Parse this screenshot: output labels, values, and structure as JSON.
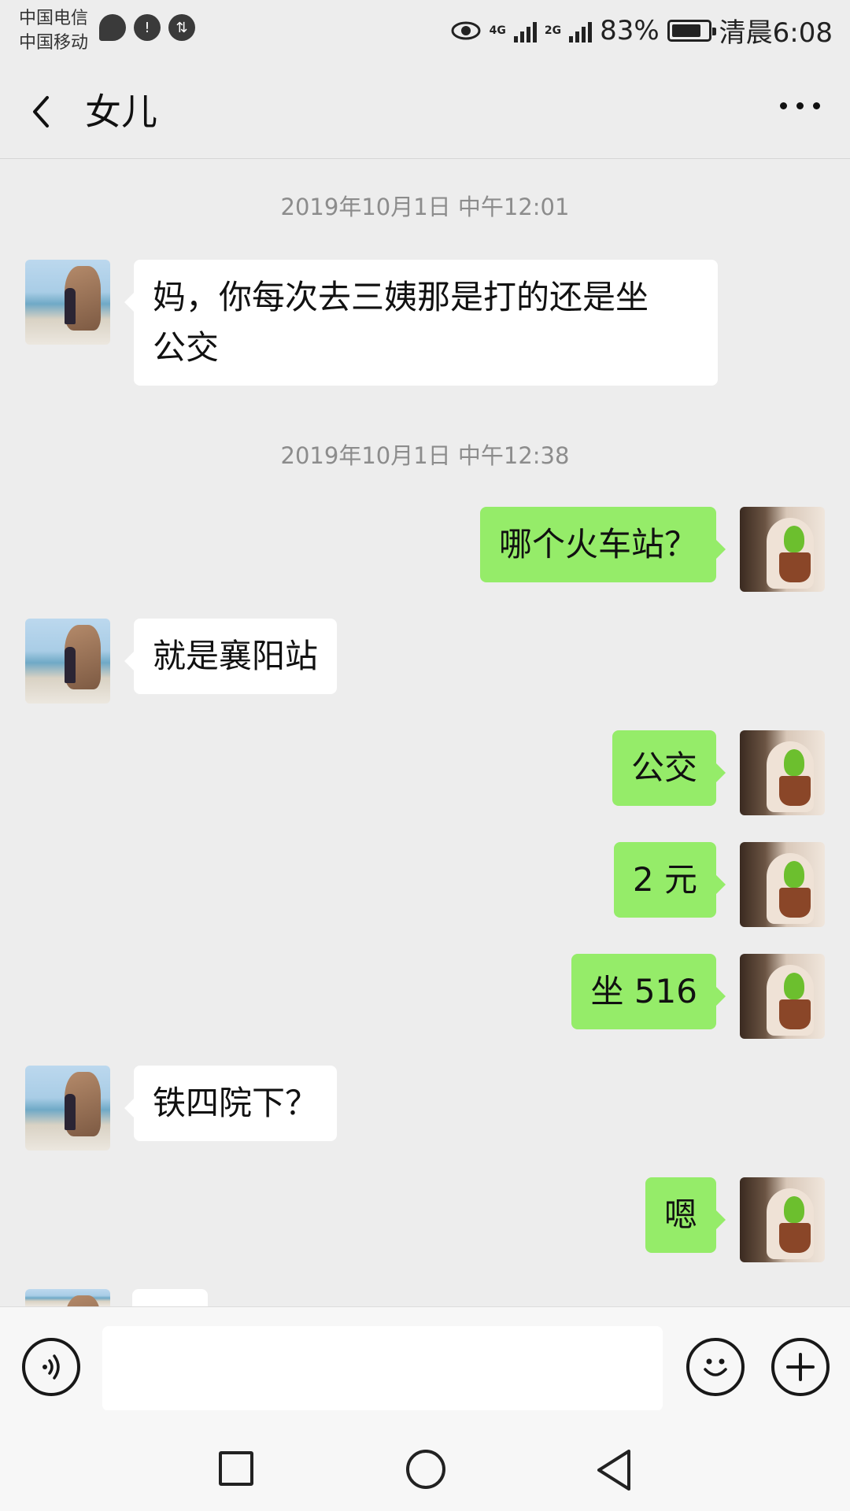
{
  "status_bar": {
    "carrier_1": "中国电信",
    "carrier_2": "中国移动",
    "net_4g": "4G",
    "net_2g": "2G",
    "battery_pct": "83%",
    "battery_level": 0.83,
    "time": "清晨6:08",
    "icons": [
      "chat-bubble-icon",
      "cloud-alert-icon",
      "data-transfer-icon",
      "eye-icon",
      "signal-icon",
      "battery-icon"
    ]
  },
  "header": {
    "title": "女儿"
  },
  "messages": [
    {
      "type": "timestamp",
      "text": "2019年10月1日 中午12:01"
    },
    {
      "type": "incoming",
      "text": "妈，你每次去三姨那是打的还是坐\n公交"
    },
    {
      "type": "timestamp",
      "text": "2019年10月1日 中午12:38"
    },
    {
      "type": "outgoing",
      "text": "哪个火车站？"
    },
    {
      "type": "incoming",
      "text": "就是襄阳站"
    },
    {
      "type": "outgoing",
      "text": "公交"
    },
    {
      "type": "outgoing",
      "text": "2 元"
    },
    {
      "type": "outgoing",
      "text": "坐 516"
    },
    {
      "type": "incoming",
      "text": "铁四院下？"
    },
    {
      "type": "outgoing",
      "text": "嗯"
    }
  ],
  "input_bar": {
    "placeholder": "",
    "icons": [
      "voice-icon",
      "emoji-icon",
      "plus-icon"
    ]
  },
  "colors": {
    "background": "#ededed",
    "outgoing_bubble": "#95ec69",
    "incoming_bubble": "#ffffff",
    "timestamp_text": "#8c8c8c"
  }
}
